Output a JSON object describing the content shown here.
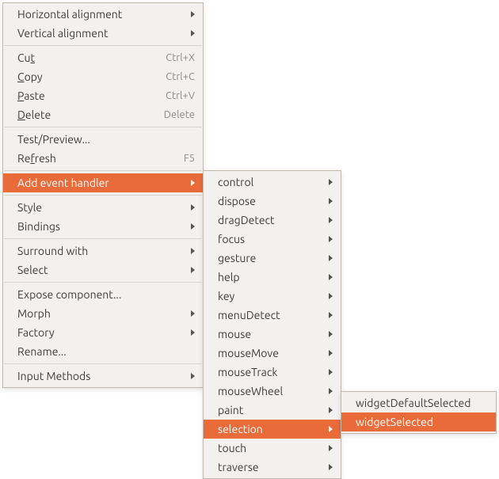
{
  "main": {
    "halign": "Horizontal alignment",
    "valign": "Vertical alignment",
    "cut": "Cut",
    "cut_mn": "t",
    "cut_accel": "Ctrl+X",
    "copy": "Copy",
    "copy_mn": "C",
    "copy_accel": "Ctrl+C",
    "paste": "Paste",
    "paste_mn": "P",
    "paste_accel": "Ctrl+V",
    "delete": "Delete",
    "delete_mn": "D",
    "delete_accel": "Delete",
    "test": "Test/Preview...",
    "refresh": "Refresh",
    "refresh_mn": "f",
    "refresh_accel": "F5",
    "add_event": "Add event handler",
    "style": "Style",
    "bindings": "Bindings",
    "surround": "Surround with",
    "select": "Select",
    "expose": "Expose component...",
    "morph": "Morph",
    "factory": "Factory",
    "rename": "Rename...",
    "input_methods": "Input Methods"
  },
  "events": {
    "control": "control",
    "dispose": "dispose",
    "dragDetect": "dragDetect",
    "focus": "focus",
    "gesture": "gesture",
    "help": "help",
    "key": "key",
    "menuDetect": "menuDetect",
    "mouse": "mouse",
    "mouseMove": "mouseMove",
    "mouseTrack": "mouseTrack",
    "mouseWheel": "mouseWheel",
    "paint": "paint",
    "selection": "selection",
    "touch": "touch",
    "traverse": "traverse"
  },
  "selection_sub": {
    "widgetDefaultSelected": "widgetDefaultSelected",
    "widgetSelected": "widgetSelected"
  }
}
